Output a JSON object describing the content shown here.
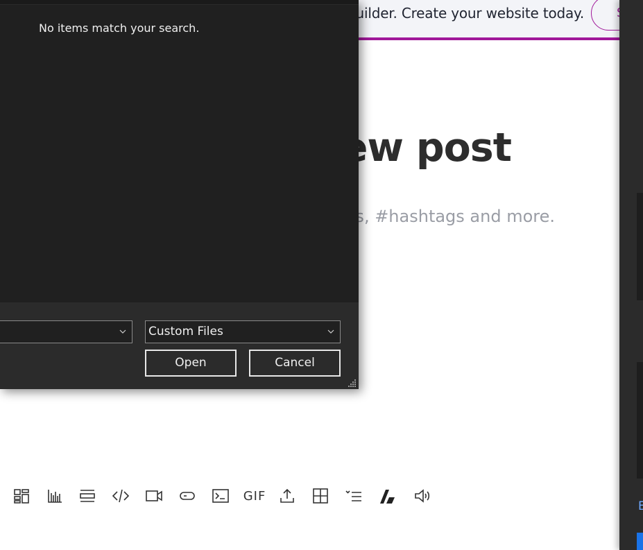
{
  "banner": {
    "text": "uilder. Create your website today.",
    "button_label": "S"
  },
  "post": {
    "title": "ew post",
    "subtitle": "os, #hashtags and more."
  },
  "right_panel": {
    "letter": "E"
  },
  "dialog": {
    "empty_message": "No items match your search.",
    "filename_value": "",
    "filetype_value": "Custom Files",
    "open_label": "Open",
    "cancel_label": "Cancel"
  },
  "toolbar": {
    "items": [
      {
        "icon": "gallery-icon"
      },
      {
        "icon": "chart-icon"
      },
      {
        "icon": "divider-icon"
      },
      {
        "icon": "code-icon"
      },
      {
        "icon": "video-icon"
      },
      {
        "icon": "button-icon"
      },
      {
        "icon": "terminal-icon"
      },
      {
        "icon": "gif-icon",
        "label": "GIF"
      },
      {
        "icon": "upload-icon"
      },
      {
        "icon": "table-icon"
      },
      {
        "icon": "collapsible-list-icon"
      },
      {
        "icon": "brand-icon"
      },
      {
        "icon": "audio-icon"
      }
    ]
  },
  "colors": {
    "accent": "#a0189a",
    "dialog_bg": "#202020",
    "footer_bg": "#2b2b2b"
  }
}
